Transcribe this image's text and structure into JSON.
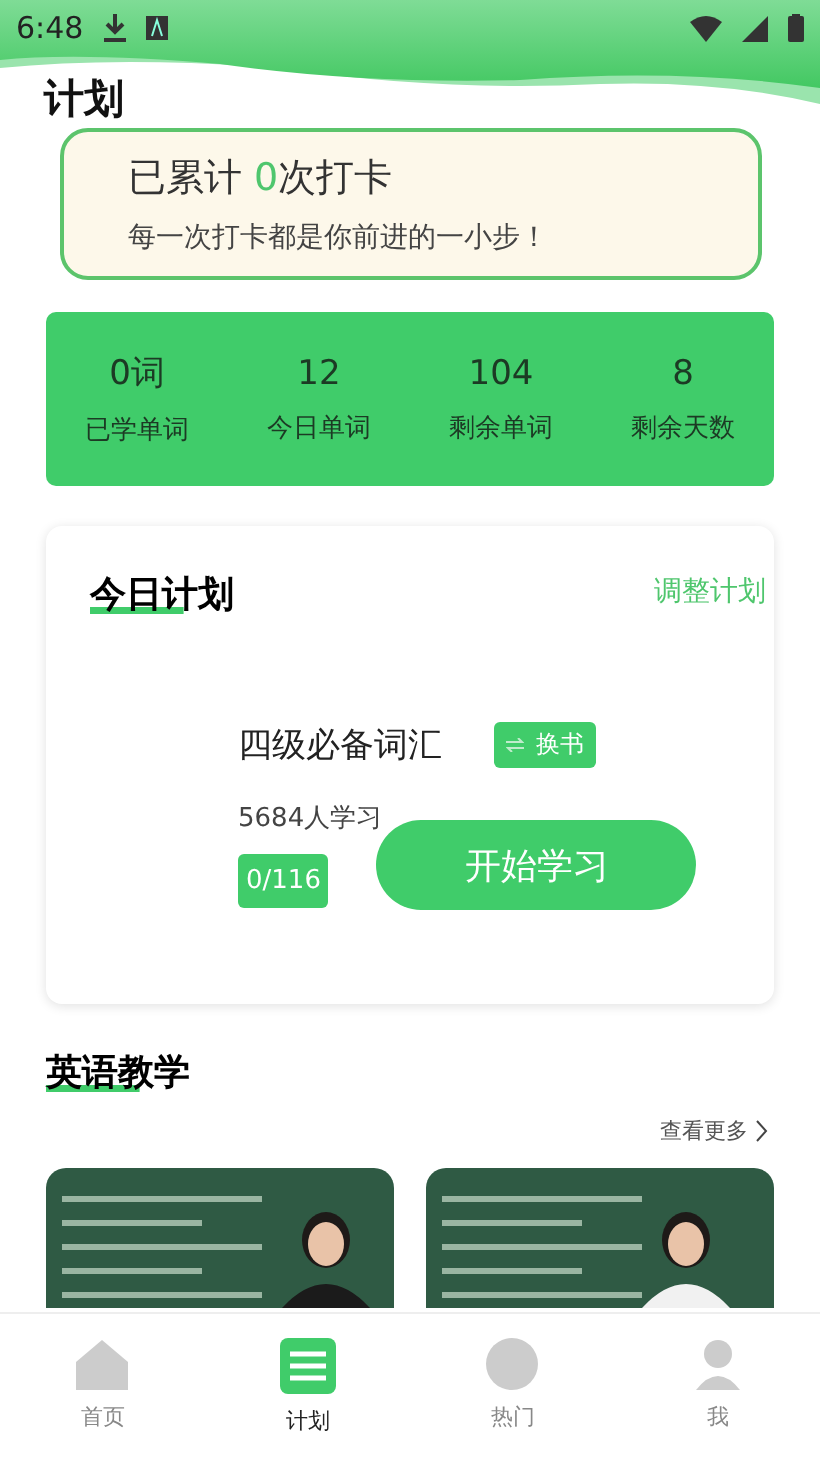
{
  "status_bar": {
    "time": "6:48"
  },
  "page_title": "计划",
  "checkin": {
    "prefix": "已累计 ",
    "count": "0",
    "suffix": "次打卡",
    "motto": "每一次打卡都是你前进的一小步！"
  },
  "stats": [
    {
      "value": "0词",
      "label": "已学单词"
    },
    {
      "value": "12",
      "label": "今日单词"
    },
    {
      "value": "104",
      "label": "剩余单词"
    },
    {
      "value": "8",
      "label": "剩余天数"
    }
  ],
  "plan": {
    "title": "今日计划",
    "adjust": "调整计划",
    "book": "四级必备词汇",
    "switch": "换书",
    "learners": "5684人学习",
    "progress": "0/116",
    "start": "开始学习"
  },
  "teaching": {
    "title": "英语教学",
    "more": "查看更多"
  },
  "tabs": [
    {
      "label": "首页",
      "kind": "home",
      "selected": false
    },
    {
      "label": "计划",
      "kind": "plan",
      "selected": true
    },
    {
      "label": "热门",
      "kind": "hot",
      "selected": false
    },
    {
      "label": "我",
      "kind": "me",
      "selected": false
    }
  ]
}
